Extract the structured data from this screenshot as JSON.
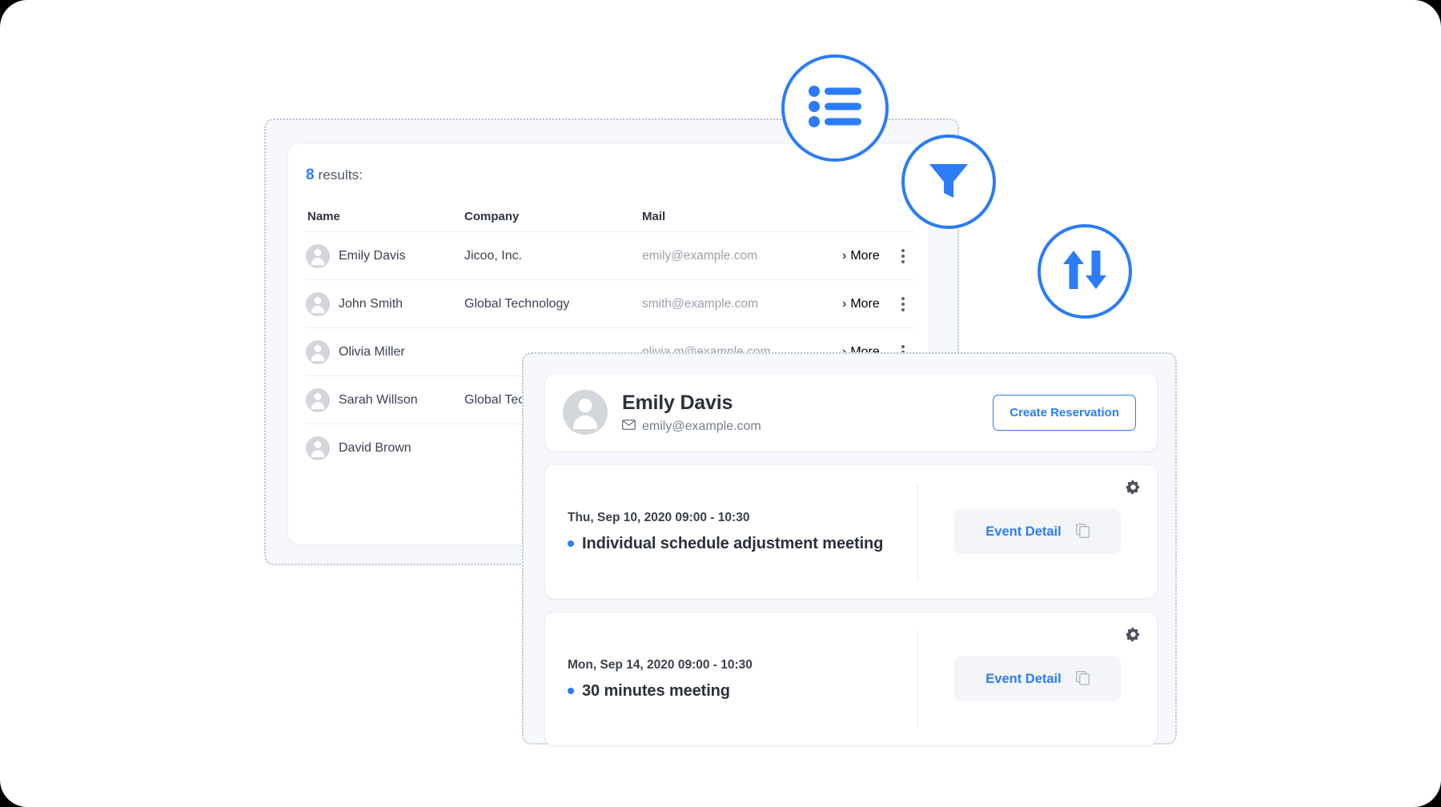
{
  "theme": {
    "accent": "#2b7cf6",
    "panel_bg": "#f6f8fb",
    "card_bg": "#ffffff",
    "text_primary": "#2b303b",
    "text_muted": "#9aa1ac",
    "avatar_gray": "#d3d6da"
  },
  "results_panel": {
    "count": "8",
    "count_suffix": " results:",
    "columns": [
      "Name",
      "Company",
      "Mail"
    ],
    "more_label": "More",
    "rows": [
      {
        "name": "Emily Davis",
        "company": "Jicoo, Inc.",
        "mail": "emily@example.com"
      },
      {
        "name": "John Smith",
        "company": "Global Technology",
        "mail": "smith@example.com"
      },
      {
        "name": "Olivia Miller",
        "company": "",
        "mail": "olivia.m@example.com"
      },
      {
        "name": "Sarah Willson",
        "company": "Global Technology",
        "mail": ""
      },
      {
        "name": "David Brown",
        "company": "",
        "mail": ""
      }
    ],
    "pagination": {
      "prev_label": "‹"
    }
  },
  "detail_panel": {
    "profile": {
      "name": "Emily Davis",
      "mail": "emily@example.com",
      "create_button": "Create Reservation"
    },
    "events": [
      {
        "date": "Thu, Sep 10, 2020 09:00 - 10:30",
        "title": "Individual schedule adjustment meeting",
        "detail_button": "Event Detail"
      },
      {
        "date": "Mon, Sep 14, 2020 09:00 - 10:30",
        "title": "30 minutes meeting",
        "detail_button": "Event Detail"
      }
    ]
  },
  "floating_icons": [
    {
      "name": "list-icon",
      "meaning": "list view"
    },
    {
      "name": "filter-icon",
      "meaning": "filter"
    },
    {
      "name": "sort-icon",
      "meaning": "sort ascending descending"
    }
  ]
}
